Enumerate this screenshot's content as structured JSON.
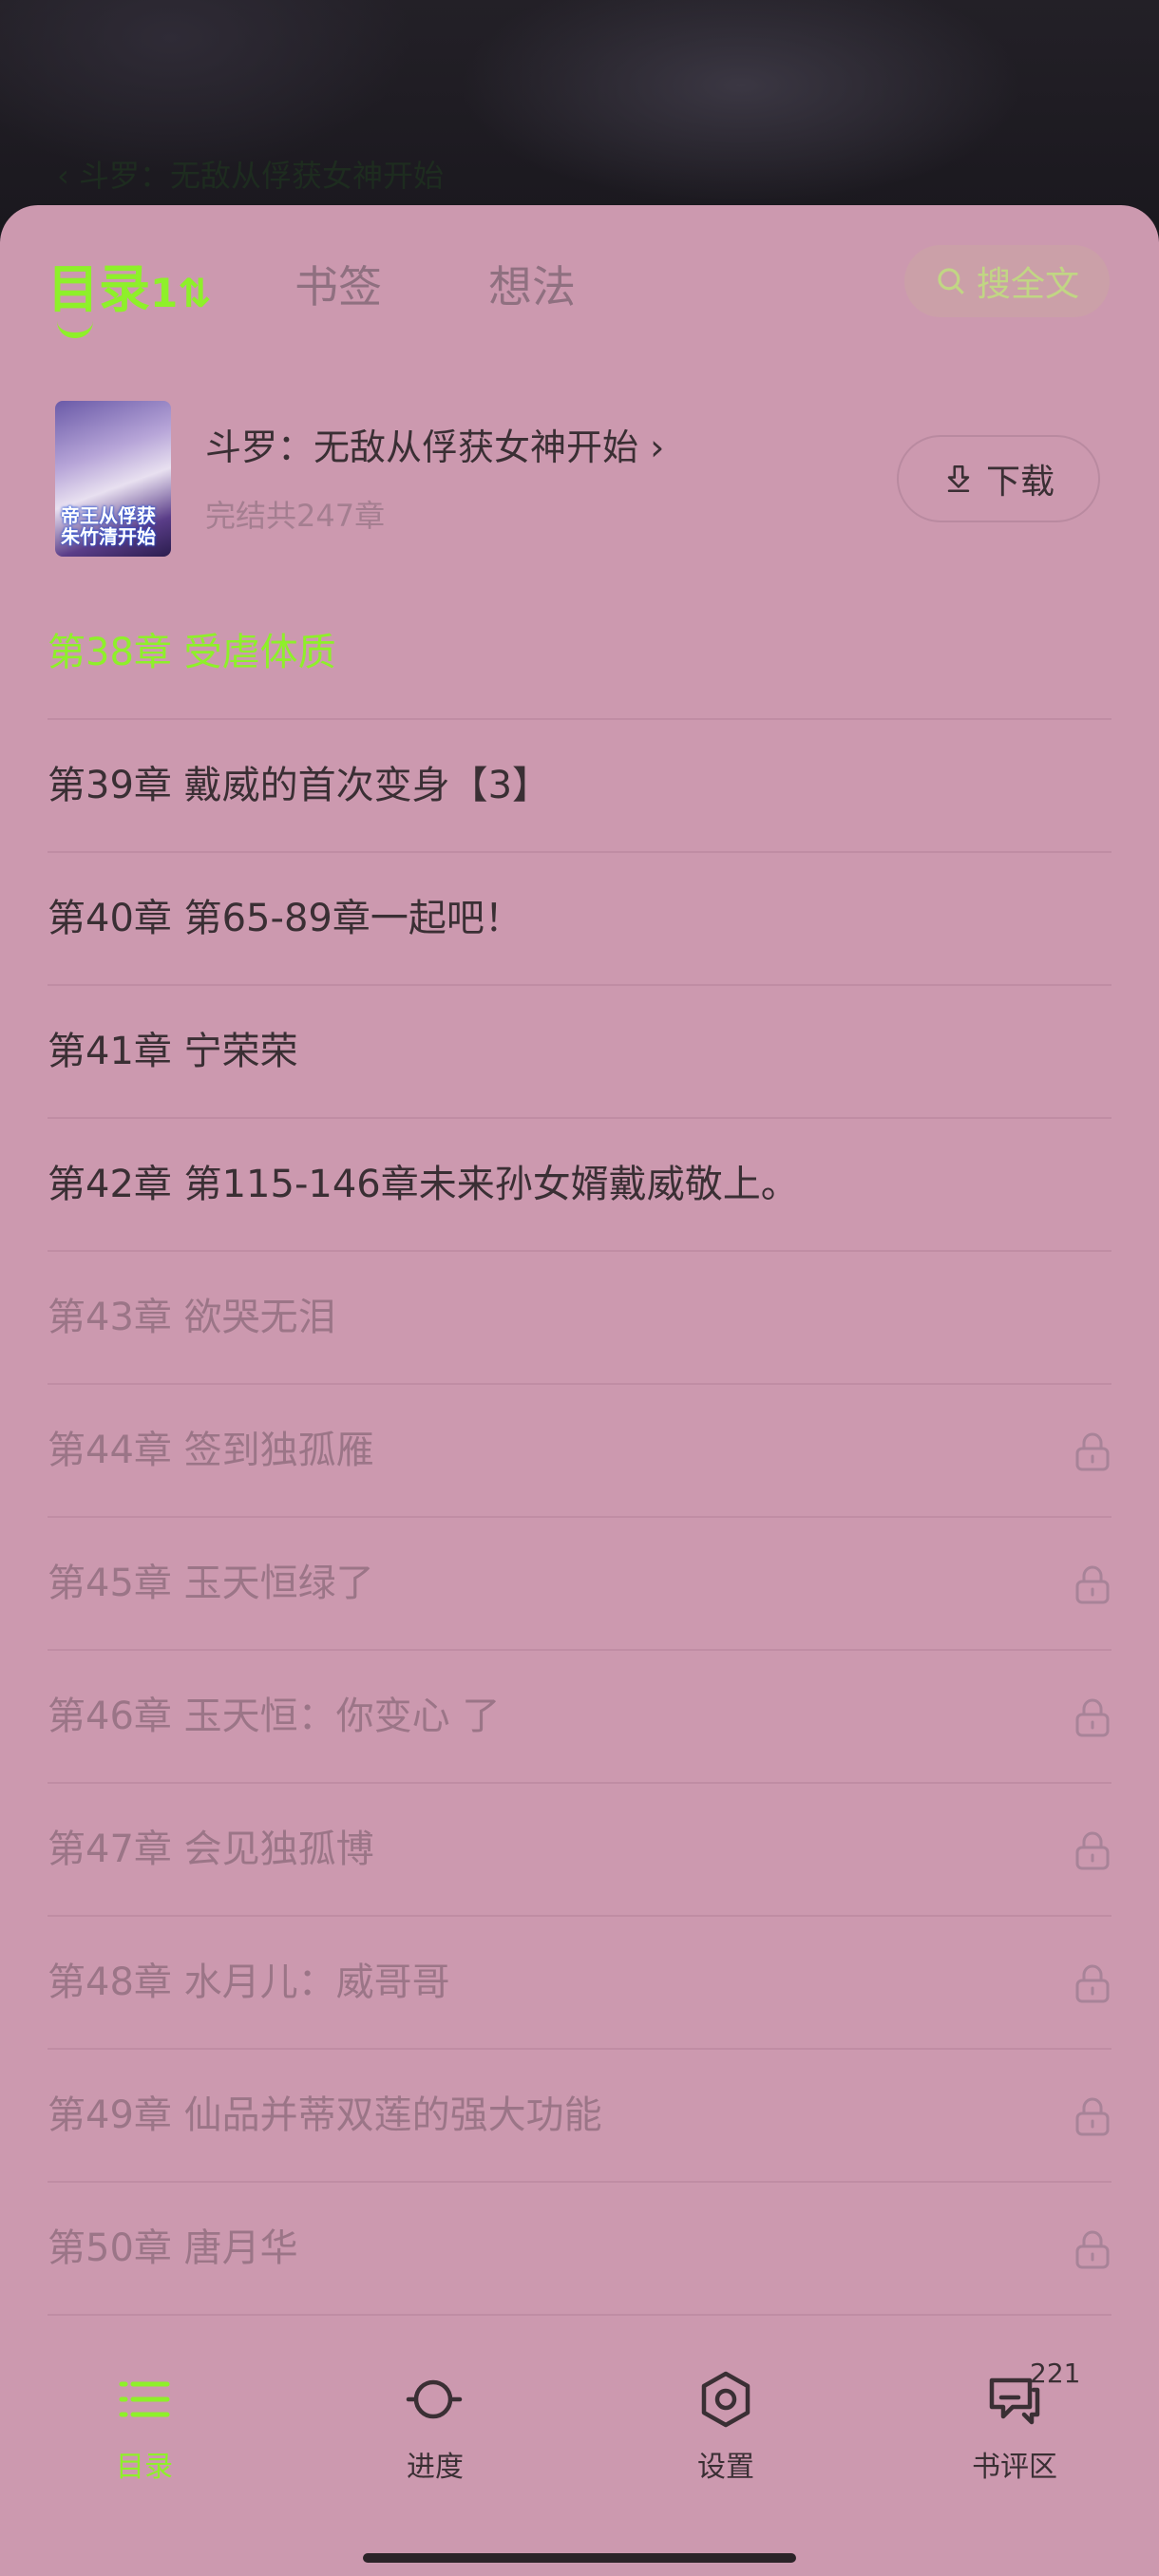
{
  "reader": {
    "title": "‹ 斗罗：无敌从俘获女神开始"
  },
  "tabs": [
    {
      "label": "目录",
      "count": "1⇅"
    },
    {
      "label": "书签"
    },
    {
      "label": "想法"
    }
  ],
  "search": {
    "label": "搜全文",
    "icon": "search-icon"
  },
  "book": {
    "title": "斗罗：无敌从俘获女神开始 ›",
    "subtitle": "完结共247章",
    "cover_text": "帝王从俘获朱竹清开始",
    "download_label": "下载"
  },
  "chapters": [
    {
      "label": "第38章 受虐体质",
      "state": "current",
      "locked": false
    },
    {
      "label": "第39章 戴威的首次变身【3】",
      "state": "read",
      "locked": false
    },
    {
      "label": "第40章 第65-89章一起吧！",
      "state": "read",
      "locked": false
    },
    {
      "label": "第41章 宁荣荣",
      "state": "read",
      "locked": false
    },
    {
      "label": "第42章 第115-146章未来孙女婿戴威敬上。",
      "state": "read",
      "locked": false
    },
    {
      "label": "第43章 欲哭无泪",
      "state": "unread",
      "locked": false
    },
    {
      "label": "第44章 签到独孤雁",
      "state": "unread",
      "locked": true
    },
    {
      "label": "第45章 玉天恒绿了",
      "state": "unread",
      "locked": true
    },
    {
      "label": "第46章 玉天恒：你变心 了",
      "state": "unread",
      "locked": true
    },
    {
      "label": "第47章 会见独孤博",
      "state": "unread",
      "locked": true
    },
    {
      "label": "第48章 水月儿：威哥哥",
      "state": "unread",
      "locked": true
    },
    {
      "label": "第49章 仙品并蒂双莲的强大功能",
      "state": "unread",
      "locked": true
    },
    {
      "label": "第50章 唐月华",
      "state": "unread",
      "locked": true
    }
  ],
  "bottom_nav": [
    {
      "label": "目录",
      "icon": "list-icon",
      "active": true
    },
    {
      "label": "进度",
      "icon": "progress-icon",
      "active": false
    },
    {
      "label": "设置",
      "icon": "settings-icon",
      "active": false
    },
    {
      "label": "书评区",
      "icon": "comments-icon",
      "active": false,
      "badge": "221"
    }
  ],
  "colors": {
    "accent": "#8ef02a",
    "sheet": "#cc99af",
    "text": "#3a2f34",
    "muted": "#9b7587"
  }
}
